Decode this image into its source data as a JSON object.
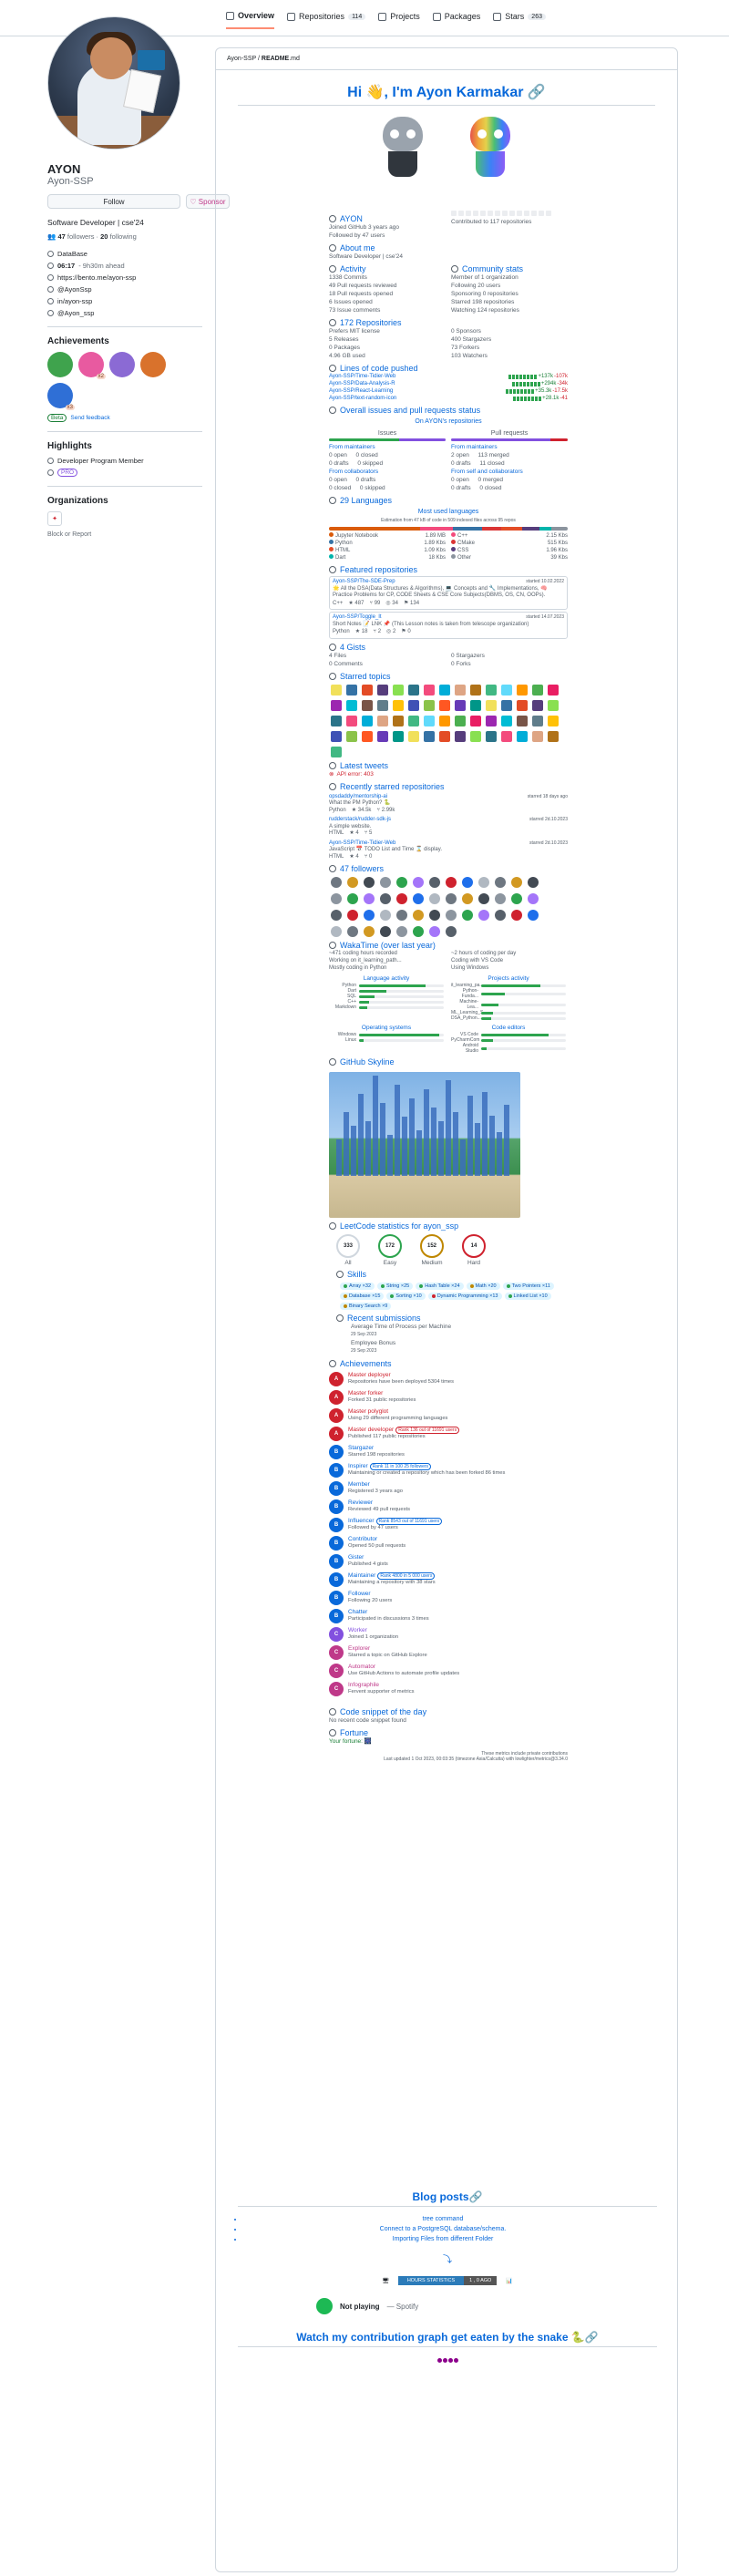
{
  "tabs": [
    {
      "label": "Overview",
      "count": ""
    },
    {
      "label": "Repositories",
      "count": "114"
    },
    {
      "label": "Projects",
      "count": ""
    },
    {
      "label": "Packages",
      "count": ""
    },
    {
      "label": "Stars",
      "count": "263"
    }
  ],
  "profile": {
    "name": "AYON",
    "login": "Ayon-SSP",
    "follow_label": "Follow",
    "sponsor_label": "Sponsor",
    "bio": "Software Developer | cse'24",
    "followers": "47",
    "followers_label": "followers",
    "following": "20",
    "following_label": "following",
    "company": "DataBase",
    "local_time": "06:17",
    "local_time_sub": "- 9h30m ahead",
    "website": "https://bento.me/ayon-ssp",
    "twitter": "@AyonSsp",
    "linkedin": "in/ayon-ssp",
    "email": "@Ayon_ssp"
  },
  "sidebar": {
    "achievements_title": "Achievements",
    "badge_x2": "x2",
    "badge_x3": "x3",
    "beta_label": "Beta",
    "feedback_label": "Send feedback",
    "highlights_title": "Highlights",
    "highlight_item": "Developer Program Member",
    "pro_label": "PRO",
    "organizations_title": "Organizations",
    "block_label": "Block or Report"
  },
  "readme": {
    "breadcrumb_user": "Ayon-SSP",
    "breadcrumb_file": "README",
    "breadcrumb_ext": ".md",
    "greeting": "Hi 👋, I'm Ayon Karmakar",
    "blog_title": "Blog posts",
    "blog_posts": [
      "tree command",
      "Connect to a PostgreSQL database/schema.",
      "Importing Files from different Folder"
    ],
    "waka_label": "HOURS STATISTICS",
    "waka_value": "1 , 0 AGO",
    "spotify_state": "Not playing",
    "spotify_sep": "— Spotify",
    "snake_title": "Watch my contribution graph get eaten by the snake 🐍"
  },
  "metrics": {
    "user_name": "AYON",
    "joined": "Joined GitHub 3 years ago",
    "followed_by": "Followed by 47 users",
    "contributed_to": "Contributed to 117 repositories",
    "about_title": "About me",
    "about_text": "Software Developer | cse'24",
    "activity_title": "Activity",
    "community_title": "Community stats",
    "activity": [
      "1338 Commits",
      "49 Pull requests reviewed",
      "18 Pull requests opened",
      "6 Issues opened",
      "73 Issue comments"
    ],
    "community": [
      "Member of 1 organization",
      "Following 20 users",
      "Sponsoring 0 repositories",
      "Starred 198 repositories",
      "Watching 124 repositories"
    ],
    "repos_title": "172 Repositories",
    "repos_left": [
      "Prefers MIT license",
      "5 Releases",
      "0 Packages",
      "4.96 GB used"
    ],
    "repos_right": [
      "0 Sponsors",
      "400 Stargazers",
      "73 Forkers",
      "103 Watchers"
    ],
    "loc_title": "Lines of code pushed",
    "loc": [
      {
        "repo": "Ayon-SSP/Time-Tidier-Web",
        "add": "+137k",
        "del": "-107k"
      },
      {
        "repo": "Ayon-SSP/Data-Analysis-R",
        "add": "+294k",
        "del": "-34k"
      },
      {
        "repo": "Ayon-SSP/React-Learning",
        "add": "+35.3k",
        "del": "-17.5k"
      },
      {
        "repo": "Ayon-SSP/text-random-icon",
        "add": "+28.1k",
        "del": "-41"
      }
    ],
    "overall_title": "Overall issues and pull requests status",
    "on_repos_title": "On AYON's repositories",
    "issues_title": "Issues",
    "prs_title": "Pull requests",
    "issues_block": [
      "From maintainers",
      "0 open",
      "0 closed",
      "0 drafts",
      "0 skipped"
    ],
    "prs_block": [
      "From maintainers",
      "2 open",
      "0 drafts",
      "113 merged",
      "11 closed"
    ],
    "issues_block2": [
      "From collaborators",
      "0 open",
      "0 drafts",
      "0 closed",
      "0 skipped"
    ],
    "prs_block2": [
      "From self and collaborators",
      "0 open",
      "0 drafts",
      "0 merged",
      "0 closed"
    ],
    "languages_title": "29 Languages",
    "most_used": "Most used languages",
    "lang_note": "Estimation from 47 kB of code in 509 indexed files across 95 repos",
    "languages": [
      {
        "name": "Jupyter Notebook",
        "size": "1.89 MB",
        "color": "#da5b0b",
        "share": 38
      },
      {
        "name": "C++",
        "size": "2.15 Kbs",
        "color": "#f34b7d",
        "share": 14
      },
      {
        "name": "Python",
        "size": "1.89 Kbs",
        "color": "#3572a5",
        "share": 12
      },
      {
        "name": "CMake",
        "size": "515 Kbs",
        "color": "#da3434",
        "share": 8
      },
      {
        "name": "HTML",
        "size": "1.09 Kbs",
        "color": "#e34c26",
        "share": 9
      },
      {
        "name": "CSS",
        "size": "1.96 Kbs",
        "color": "#563d7c",
        "share": 7
      },
      {
        "name": "Dart",
        "size": "18 Kbs",
        "color": "#00b4ab",
        "share": 5
      },
      {
        "name": "Other",
        "size": "39 Kbs",
        "color": "#8b949e",
        "share": 7
      }
    ],
    "featured_title": "Featured repositories",
    "featured": [
      {
        "name": "Ayon-SSP/The-SDE-Prep",
        "date": "started 10.02.2022",
        "desc": "🌟 All the DSA(Data Structures & Algorithms), 💻 Concepts and 🔧 Implementations, 🧠 Practice Problems for CP, CODE Sheets & CSE Core Subjects(DBMS, OS, CN, OOPs).",
        "lang": "C++",
        "s1": "487",
        "s2": "99",
        "s3": "34",
        "s4": "134"
      },
      {
        "name": "Ayon-SSP/Toggle_It",
        "date": "started 14.07.2023",
        "desc": "Short Notes 📝 LNK 📌 (This Lesson notes is taken from telescope organization)",
        "lang": "Python",
        "s1": "18",
        "s2": "2",
        "s3": "2",
        "s4": "0"
      }
    ],
    "gists_title": "4 Gists",
    "gists_left": [
      "4 Files",
      "0 Comments"
    ],
    "gists_right": [
      "0 Stargazers",
      "0 Forks"
    ],
    "topics_title": "Starred topics",
    "tweets_title": "Latest tweets",
    "tweets_error": "API error: 403",
    "starred_title": "Recently starred repositories",
    "starred": [
      {
        "name": "opsdaddy/mentorship-ai",
        "date": "starred 18 days ago",
        "desc": "What the PM Python? 🐍",
        "lang": "Python",
        "s1": "34.5k",
        "s2": "2.99k"
      },
      {
        "name": "rudderstack/rudder-sdk-js",
        "date": "starred 2d.10.2023",
        "desc": "A simple website.",
        "lang": "HTML",
        "s1": "4",
        "s2": "5"
      },
      {
        "name": "Ayon-SSP/Time-Tidier-Web",
        "date": "starred 2d.10.2023",
        "desc": "JavaScript 📅 TODO List and Time ⌛ display.",
        "lang": "HTML",
        "s1": "4",
        "s2": "0"
      }
    ],
    "followers_title": "47 followers",
    "waka_title": "WakaTime (over last year)",
    "waka_left": [
      "~471 coding hours recorded",
      "Working on it_learning_path...",
      "Mostly coding in Python"
    ],
    "waka_right": [
      "~2 hours of coding per day",
      "Coding with VS Code",
      "Using Windows"
    ],
    "lang_activity": "Language activity",
    "proj_activity": "Projects activity",
    "lang_act": [
      {
        "name": "Python",
        "pct": 78
      },
      {
        "name": "Dart",
        "pct": 32
      },
      {
        "name": "SQL",
        "pct": 18
      },
      {
        "name": "C++",
        "pct": 12
      },
      {
        "name": "Markdown",
        "pct": 10
      }
    ],
    "proj_act": [
      {
        "name": "it_learning_pa...",
        "pct": 70
      },
      {
        "name": "Python-Funda...",
        "pct": 28
      },
      {
        "name": "Machine-Lea...",
        "pct": 20
      },
      {
        "name": "ML_Learning_S...",
        "pct": 14
      },
      {
        "name": "DSA_Python...",
        "pct": 12
      }
    ],
    "os_title": "Operating systems",
    "editors_title": "Code editors",
    "os": [
      {
        "name": "Windows",
        "pct": 95
      },
      {
        "name": "Linux",
        "pct": 5
      }
    ],
    "editors": [
      {
        "name": "VS Code",
        "pct": 80
      },
      {
        "name": "PyCharmCom",
        "pct": 14
      },
      {
        "name": "Android Studio",
        "pct": 6
      }
    ],
    "skyline_title": "GitHub Skyline",
    "leetcode_title": "LeetCode statistics for ayon_ssp",
    "leetcode": [
      {
        "label": "All",
        "value": "333",
        "sub": "/3057"
      },
      {
        "label": "Easy",
        "value": "172",
        "sub": "/790"
      },
      {
        "label": "Medium",
        "value": "152",
        "sub": "/1597"
      },
      {
        "label": "Hard",
        "value": "14",
        "sub": "/670"
      }
    ],
    "skills_title": "Skills",
    "skills": [
      {
        "name": "Array ×32",
        "color": "#2da44e"
      },
      {
        "name": "String ×25",
        "color": "#2da44e"
      },
      {
        "name": "Hash Table ×24",
        "color": "#2da44e"
      },
      {
        "name": "Math ×20",
        "color": "#bf8700"
      },
      {
        "name": "Two Pointers ×11",
        "color": "#2da44e"
      },
      {
        "name": "Database ×15",
        "color": "#bf8700"
      },
      {
        "name": "Sorting ×10",
        "color": "#2da44e"
      },
      {
        "name": "Dynamic Programming ×13",
        "color": "#cf222e"
      },
      {
        "name": "Linked List ×10",
        "color": "#2da44e"
      },
      {
        "name": "Binary Search ×9",
        "color": "#bf8700"
      }
    ],
    "recent_title": "Recent submissions",
    "recent": [
      "Average Time of Process per Machine",
      "29 Sep 2023",
      "Employee Bonus",
      "29 Sep 2023"
    ],
    "achievements_title": "Achievements",
    "achievements": [
      {
        "rank": "A",
        "name": "Master deployer",
        "tag": "",
        "desc": "Repositories have been deployed 5304 times",
        "color": "#cf222e"
      },
      {
        "rank": "A",
        "name": "Master forker",
        "tag": "",
        "desc": "Forked 31 public repositories",
        "color": "#cf222e"
      },
      {
        "rank": "A",
        "name": "Master polyglot",
        "tag": "",
        "desc": "Using 29 different programming languages",
        "color": "#cf222e"
      },
      {
        "rank": "A",
        "name": "Master developer",
        "tag": "Rank 136 out of 11691 users",
        "desc": "Published 117 public repositories",
        "color": "#cf222e"
      },
      {
        "rank": "B",
        "name": "Stargazer",
        "tag": "",
        "desc": "Starred 198 repositories",
        "color": "#0969da"
      },
      {
        "rank": "B",
        "name": "Inspirer",
        "tag": "Rank 11 in 100 25 followers",
        "desc": "Maintaining or created a repository which has been forked 86 times",
        "color": "#0969da"
      },
      {
        "rank": "B",
        "name": "Member",
        "tag": "",
        "desc": "Registered 3 years ago",
        "color": "#0969da"
      },
      {
        "rank": "B",
        "name": "Reviewer",
        "tag": "",
        "desc": "Reviewed 49 pull requests",
        "color": "#0969da"
      },
      {
        "rank": "B",
        "name": "Influencer",
        "tag": "Rank 8543 out of 11691 users",
        "desc": "Followed by 47 users",
        "color": "#0969da"
      },
      {
        "rank": "B",
        "name": "Contributor",
        "tag": "",
        "desc": "Opened 50 pull requests",
        "color": "#0969da"
      },
      {
        "rank": "B",
        "name": "Gister",
        "tag": "",
        "desc": "Published 4 gists",
        "color": "#0969da"
      },
      {
        "rank": "B",
        "name": "Maintainer",
        "tag": "Rank 4800 in 5 000 users",
        "desc": "Maintaining a repository with 38 stars",
        "color": "#0969da"
      },
      {
        "rank": "B",
        "name": "Follower",
        "tag": "",
        "desc": "Following 20 users",
        "color": "#0969da"
      },
      {
        "rank": "B",
        "name": "Chatter",
        "tag": "",
        "desc": "Participated in discussions 3 times",
        "color": "#0969da"
      },
      {
        "rank": "C",
        "name": "Worker",
        "tag": "",
        "desc": "Joined 1 organization",
        "color": "#8250df"
      },
      {
        "rank": "C",
        "name": "Explorer",
        "tag": "",
        "desc": "Starred a topic on GitHub Explore",
        "color": "#bf3989"
      },
      {
        "rank": "C",
        "name": "Automator",
        "tag": "",
        "desc": "Use GitHub Actions to automate profile updates",
        "color": "#bf3989"
      },
      {
        "rank": "C",
        "name": "Infographile",
        "tag": "",
        "desc": "Fervent supporter of metrics",
        "color": "#bf3989"
      }
    ],
    "snippet_title": "Code snippet of the day",
    "snippet_text": "No recent code snippet found",
    "fortune_title": "Fortune",
    "fortune_text": "Your fortune: 🎆",
    "foot1": "These metrics include private contributions",
    "foot2": "Last updated 1 Oct 2023, 00:03:35 (timezone Asia/Calcutta) with lowlighter/metrics@3.34.0"
  },
  "colors": {
    "link": "#0969da",
    "border": "#d0d7de",
    "tab_active": "#fd8c73",
    "green": "#2da44e",
    "red": "#cf222e"
  }
}
